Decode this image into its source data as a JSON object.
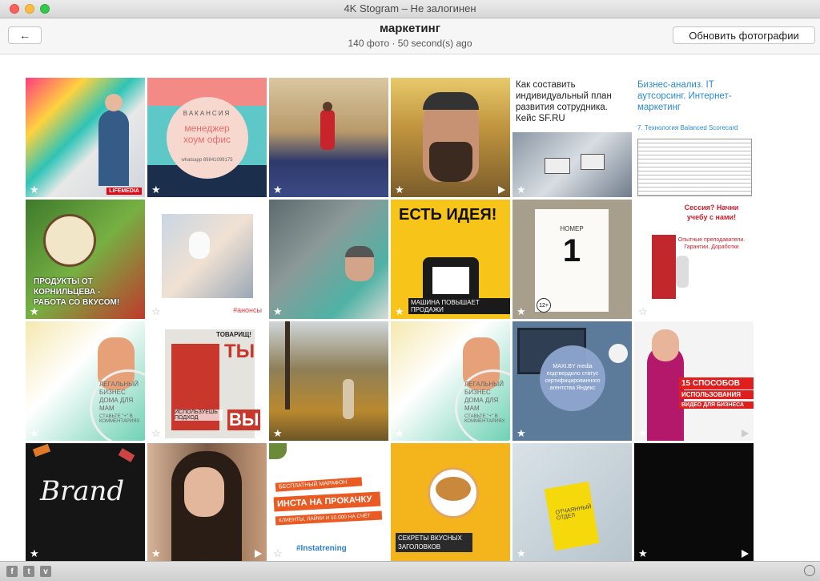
{
  "window": {
    "title": "4K Stogram – Не залогинен"
  },
  "header": {
    "back_icon": "←",
    "title": "маркетинг",
    "subtitle": "140 фото · 50 second(s) ago",
    "refresh_label": "Обновить фотографии"
  },
  "tiles": [
    {
      "caption": "LIFEMEDIA"
    },
    {
      "caption": "ВАКАНСИЯ",
      "caption2": "менеджер хоум офис",
      "caption3": "whatsapp 89841099175"
    },
    {
      "caption": ""
    },
    {
      "caption": ""
    },
    {
      "caption": "Как составить индивидуальный план развития сотрудника. Кейс SF.RU"
    },
    {
      "caption": "Бизнес-анализ. IT аутсорсинг. Интернет-маркетинг",
      "caption2": "7. Технология Balanced Scorecard"
    },
    {
      "caption": "ПРОДУКТЫ ОТ КОРНИЛЬЦЕВА - РАБОТА СО ВКУСОМ!"
    },
    {
      "caption": "#анонсы"
    },
    {
      "caption": ""
    },
    {
      "caption": "ЕСТЬ ИДЕЯ!",
      "caption2": "МАШИНА ПОВЫШАЕТ ПРОДАЖИ"
    },
    {
      "caption": "НОМЕР",
      "caption2": "1",
      "caption3": "12+"
    },
    {
      "caption": "Сессия? Начни учебу с нами!",
      "caption2": "Опытные преподаватели. Гарантии. Доработки"
    },
    {
      "caption": "ЛЕГАЛЬНЫЙ БИЗНЕС ДОМА ДЛЯ МАМ",
      "caption2": "СТАВЬТЕ \"+\" В КОММЕНТАРИЯХ"
    },
    {
      "caption": "ТОВАРИЩ!",
      "caption2": "ТЫ",
      "caption3": "ИСПОЛЬЗУЕШЬ ПОДХОД",
      "caption4": "ВЫ"
    },
    {
      "caption": ""
    },
    {
      "caption": "ЛЕГАЛЬНЫЙ БИЗНЕС ДОМА ДЛЯ МАМ",
      "caption2": "СТАВЬТЕ \"+\" В КОММЕНТАРИЯХ"
    },
    {
      "caption": "MAXI.BY media подтвердило статус сертифицированного агентства Яндекс"
    },
    {
      "caption": "15 СПОСОБОВ",
      "caption2": "ИСПОЛЬЗОВАНИЯ",
      "caption3": "ВИДЕО ДЛЯ БИЗНЕСА"
    },
    {
      "caption": "Brand"
    },
    {
      "caption": ""
    },
    {
      "caption": "БЕСПЛАТНЫЙ МАРАФОН",
      "caption2": "ИНСТА НА ПРОКАЧКУ",
      "caption3": "КЛИЕНТЫ, ЛАЙКИ И 10.000 НА СЧЁТ",
      "caption4": "#Instatrening"
    },
    {
      "caption": "СЕКРЕТЫ ВКУСНЫХ ЗАГОЛОВКОВ"
    },
    {
      "caption": "ОТЧАЯННЫЙ ОТДЕЛ"
    },
    {
      "caption": ""
    }
  ],
  "bottom": {
    "facebook": "f",
    "twitter": "t",
    "vimeo": "v"
  }
}
